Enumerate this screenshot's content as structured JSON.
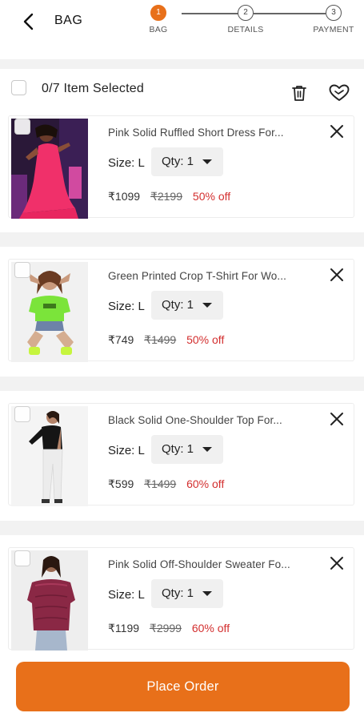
{
  "header": {
    "title": "BAG",
    "steps": [
      {
        "number": "1",
        "label": "BAG",
        "active": true
      },
      {
        "number": "2",
        "label": "DETAILS",
        "active": false
      },
      {
        "number": "3",
        "label": "PAYMENT",
        "active": false
      }
    ]
  },
  "selection": {
    "text": "0/7 Item Selected"
  },
  "items": [
    {
      "name": "Pink Solid Ruffled Short Dress For...",
      "size": "Size: L",
      "qty": "Qty: 1",
      "price": "₹1099",
      "mrp": "₹2199",
      "discount": "50% off"
    },
    {
      "name": "Green Printed Crop T-Shirt For Wo...",
      "size": "Size: L",
      "qty": "Qty: 1",
      "price": "₹749",
      "mrp": "₹1499",
      "discount": "50% off"
    },
    {
      "name": "Black Solid One-Shoulder Top For...",
      "size": "Size: L",
      "qty": "Qty: 1",
      "price": "₹599",
      "mrp": "₹1499",
      "discount": "60% off"
    },
    {
      "name": "Pink Solid Off-Shoulder Sweater Fo...",
      "size": "Size: L",
      "qty": "Qty: 1",
      "price": "₹1199",
      "mrp": "₹2999",
      "discount": "60% off"
    }
  ],
  "footer": {
    "place_order_label": "Place Order"
  },
  "colors": {
    "accent": "#e8701a",
    "discount": "#d32f2f",
    "separator": "#f2f2f2"
  },
  "icons": [
    "back-arrow-icon",
    "trash-icon",
    "wishlist-heart-icon",
    "close-icon",
    "caret-down-icon"
  ]
}
